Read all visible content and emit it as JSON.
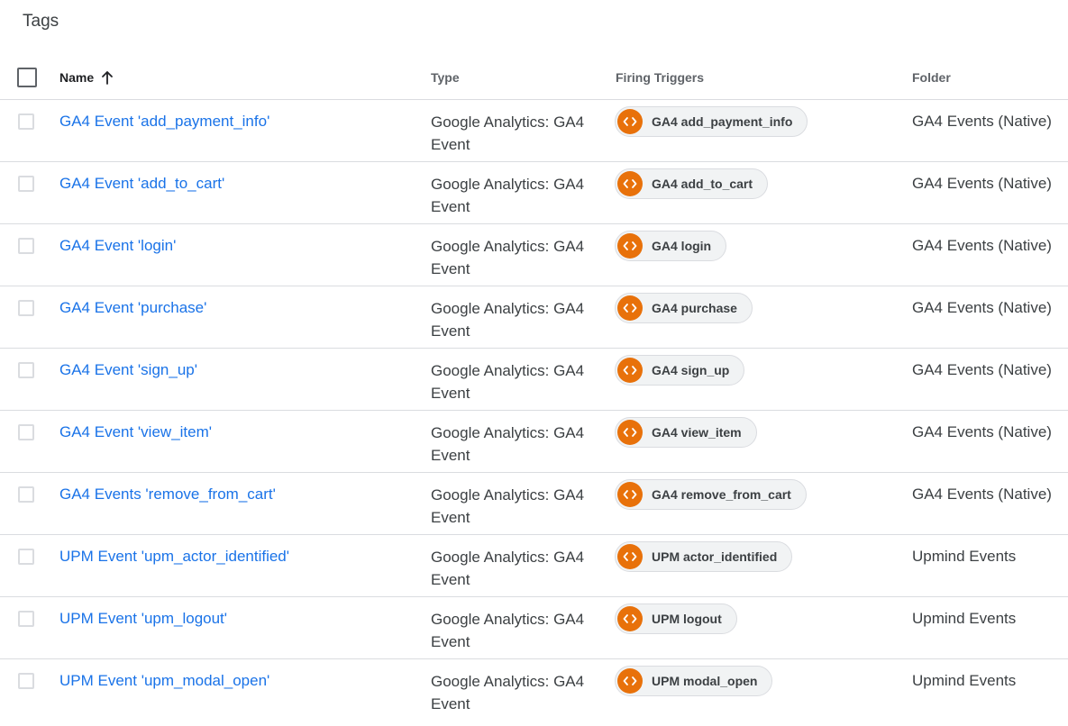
{
  "page": {
    "title": "Tags"
  },
  "table": {
    "headers": {
      "name": "Name",
      "type": "Type",
      "triggers": "Firing Triggers",
      "folder": "Folder"
    },
    "sort_icon": "arrow-up-icon",
    "trigger_icon": "code-brackets-icon",
    "accent_color": "#e8710a",
    "link_color": "#1a73e8",
    "rows": [
      {
        "name": "GA4 Event 'add_payment_info'",
        "type": "Google Analytics: GA4 Event",
        "trigger": "GA4 add_payment_info",
        "folder": "GA4 Events (Native)"
      },
      {
        "name": "GA4 Event 'add_to_cart'",
        "type": "Google Analytics: GA4 Event",
        "trigger": "GA4 add_to_cart",
        "folder": "GA4 Events (Native)"
      },
      {
        "name": "GA4 Event 'login'",
        "type": "Google Analytics: GA4 Event",
        "trigger": "GA4 login",
        "folder": "GA4 Events (Native)"
      },
      {
        "name": "GA4 Event 'purchase'",
        "type": "Google Analytics: GA4 Event",
        "trigger": "GA4 purchase",
        "folder": "GA4 Events (Native)"
      },
      {
        "name": "GA4 Event 'sign_up'",
        "type": "Google Analytics: GA4 Event",
        "trigger": "GA4 sign_up",
        "folder": "GA4 Events (Native)"
      },
      {
        "name": "GA4 Event 'view_item'",
        "type": "Google Analytics: GA4 Event",
        "trigger": "GA4 view_item",
        "folder": "GA4 Events (Native)"
      },
      {
        "name": "GA4 Events 'remove_from_cart'",
        "type": "Google Analytics: GA4 Event",
        "trigger": "GA4 remove_from_cart",
        "folder": "GA4 Events (Native)"
      },
      {
        "name": "UPM Event 'upm_actor_identified'",
        "type": "Google Analytics: GA4 Event",
        "trigger": "UPM actor_identified",
        "folder": "Upmind Events"
      },
      {
        "name": "UPM Event 'upm_logout'",
        "type": "Google Analytics: GA4 Event",
        "trigger": "UPM logout",
        "folder": "Upmind Events"
      },
      {
        "name": "UPM Event 'upm_modal_open'",
        "type": "Google Analytics: GA4 Event",
        "trigger": "UPM modal_open",
        "folder": "Upmind Events"
      }
    ]
  }
}
